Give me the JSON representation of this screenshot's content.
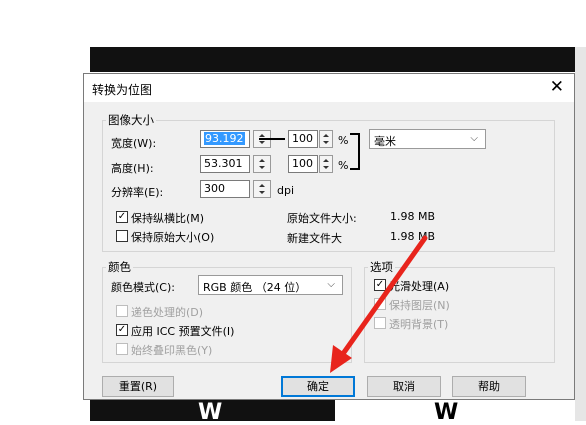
{
  "dialog": {
    "title": "转换为位图",
    "close_glyph": "✕",
    "size_group": {
      "label": "图像大小",
      "width_label": "宽度(W):",
      "width_value": "93.192",
      "width_percent": "100",
      "height_label": "高度(H):",
      "height_value": "53.301",
      "height_percent": "100",
      "percent_sign": "%",
      "unit": "毫米",
      "resolution_label": "分辨率(E):",
      "resolution_value": "300",
      "resolution_unit": "dpi",
      "keep_aspect_label": "保持纵横比(M)",
      "keep_aspect_checked": true,
      "keep_original_label": "保持原始大小(O)",
      "keep_original_checked": false,
      "original_size_label": "原始文件大小:",
      "original_size_value": "1.98 MB",
      "new_size_label": "新建文件大",
      "new_size_value": "1.98 MB"
    },
    "color_group": {
      "label": "颜色",
      "mode_label": "颜色模式(C):",
      "mode_value": "RGB 颜色 （24 位）",
      "dither_label": "递色处理的(D)",
      "icc_label": "应用 ICC 预置文件(I)",
      "overprint_label": "始终叠印黑色(Y)"
    },
    "options_group": {
      "label": "选项",
      "antialias_label": "光滑处理(A)",
      "layers_label": "保持图层(N)",
      "transparent_label": "透明背景(T)"
    },
    "buttons": {
      "reset": "重置(R)",
      "ok": "确定",
      "cancel": "取消",
      "help": "帮助"
    }
  },
  "background": {
    "logo_left": "W",
    "logo_right": "W"
  }
}
